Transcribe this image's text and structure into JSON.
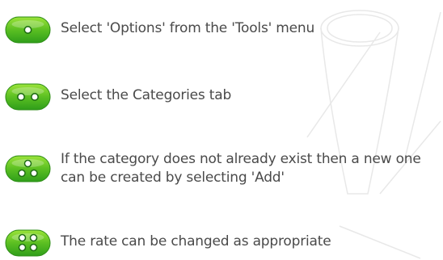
{
  "colors": {
    "button_green_light": "#7fd321",
    "button_green_dark": "#2e9d1a",
    "dot_fill": "#ffffff",
    "dot_stroke": "#1f6e12",
    "text": "#4a4a4a"
  },
  "steps": [
    {
      "icon": "one-dot-button-icon",
      "text": "Select 'Options' from the 'Tools' menu"
    },
    {
      "icon": "two-dot-button-icon",
      "text": "Select the Categories tab"
    },
    {
      "icon": "three-dot-button-icon",
      "text": "If the category does not already exist then a new one can be created by selecting 'Add'"
    },
    {
      "icon": "four-dot-button-icon",
      "text": "The rate can be changed as appropriate"
    }
  ]
}
